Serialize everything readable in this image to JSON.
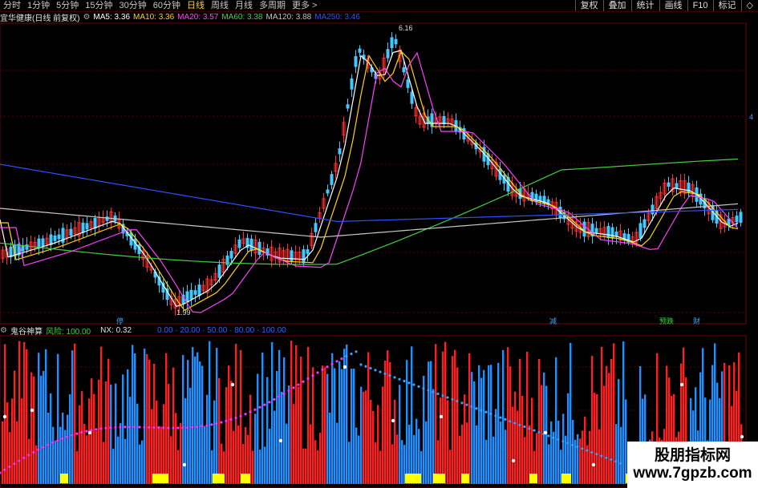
{
  "toolbar": {
    "periods": [
      "分时",
      "1分钟",
      "5分钟",
      "15分钟",
      "30分钟",
      "60分钟",
      "日线",
      "周线",
      "月线",
      "多周期",
      "更多 >"
    ],
    "active_index": 6,
    "buttons": [
      "复权",
      "叠加",
      "统计",
      "画线",
      "F10",
      "标记",
      "◇"
    ]
  },
  "main_panel": {
    "stock_title": "宜华健康(日线 前复权)",
    "ma": [
      {
        "label": "MA5: 3.36",
        "color": "#ffffff"
      },
      {
        "label": "MA10: 3.36",
        "color": "#ffd400"
      },
      {
        "label": "MA20: 3.57",
        "color": "#ff40ff"
      },
      {
        "label": "MA60: 3.38",
        "color": "#40d040"
      },
      {
        "label": "MA120: 3.88",
        "color": "#c0c0c0"
      },
      {
        "label": "MA250: 3.46",
        "color": "#3050ff"
      }
    ],
    "high_label": "6.16",
    "low_label": "1.99",
    "right_marker": "4",
    "events": [
      {
        "label": "停",
        "color": "#40a0ff"
      },
      {
        "label": "减",
        "color": "#40a0ff"
      },
      {
        "label": "预跌",
        "color": "#40d040"
      },
      {
        "label": "财",
        "color": "#40a0ff"
      }
    ],
    "colors": {
      "up": "#ff3030",
      "down": "#40c8ff",
      "grid": "#5a0000"
    }
  },
  "indicator_panel": {
    "name": "鬼谷神算",
    "risk_label": "风险: 100.00",
    "nx_label": "NX: 0.32",
    "scale_label": "0.00 · 20.00 · 50.00 · 80.00 · 100.00"
  },
  "watermark": {
    "text": "股朋指标网",
    "url": "www.7gpzb.com"
  }
}
